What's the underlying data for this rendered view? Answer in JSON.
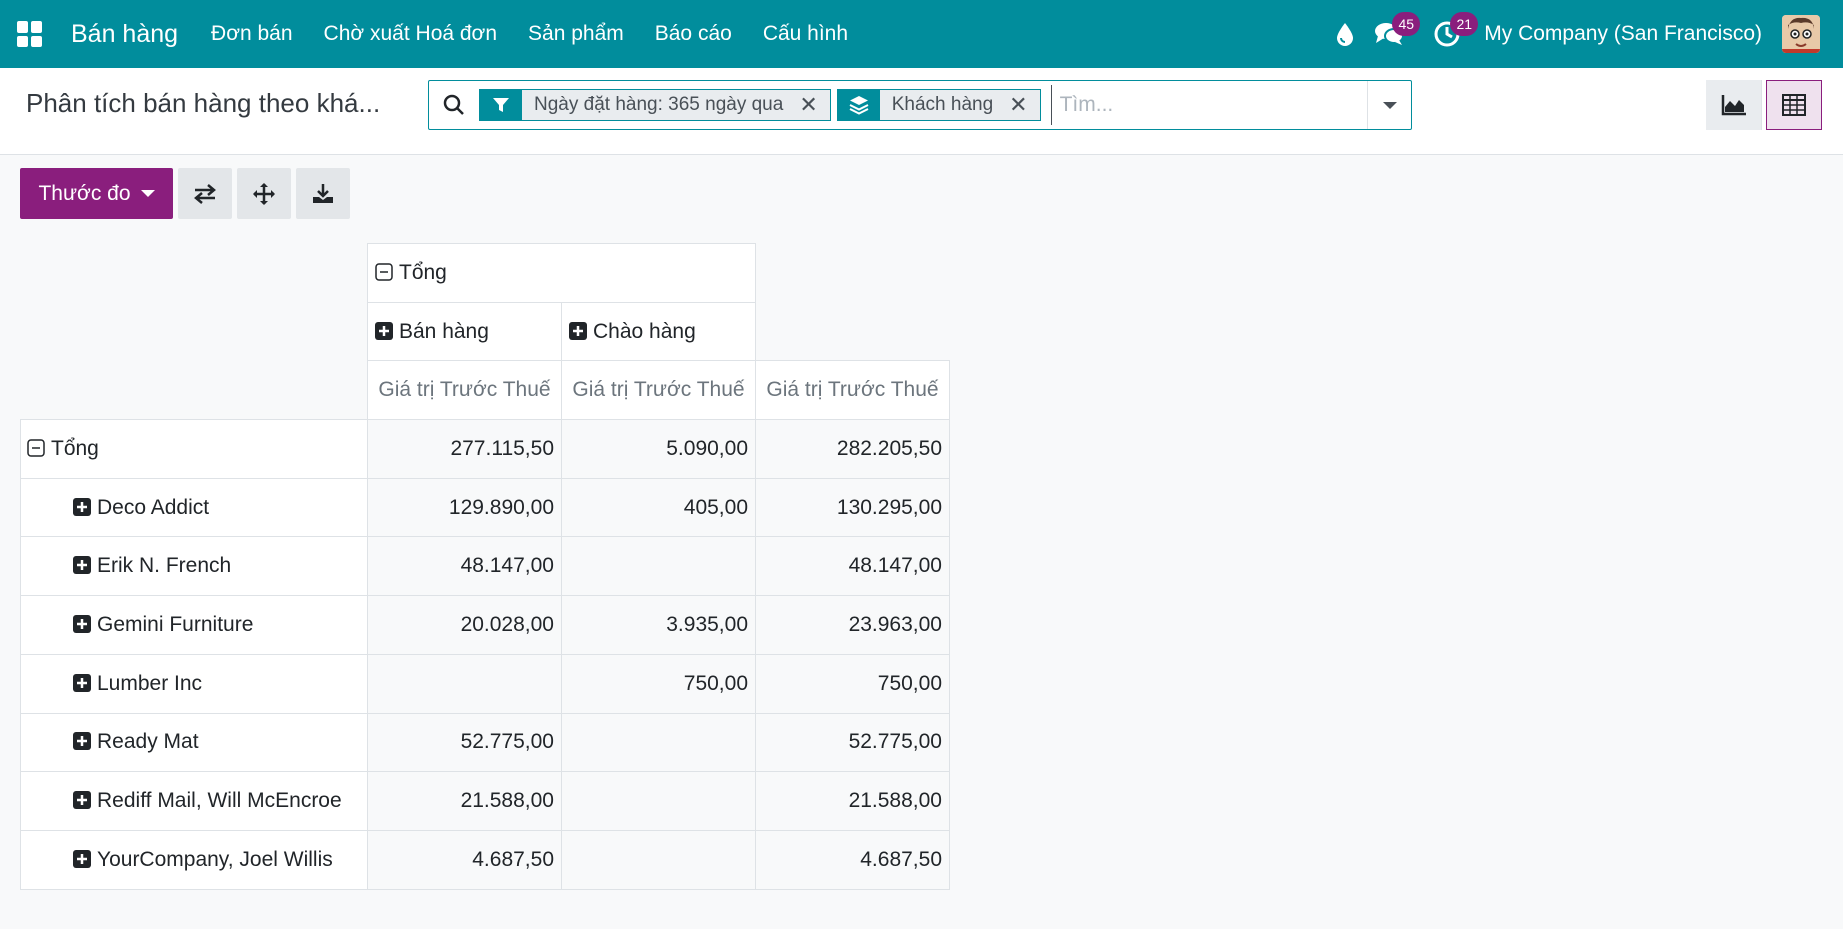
{
  "navbar": {
    "app_title": "Bán hàng",
    "menu": [
      "Đơn bán",
      "Chờ xuất Hoá đơn",
      "Sản phẩm",
      "Báo cáo",
      "Cấu hình"
    ],
    "messages_count": "45",
    "activities_count": "21",
    "company": "My Company (San Francisco)"
  },
  "control": {
    "breadcrumb": "Phân tích bán hàng theo khá...",
    "facets": [
      {
        "icon": "filter-icon",
        "label": "Ngày đặt hàng: 365 ngày qua"
      },
      {
        "icon": "group-by-icon",
        "label": "Khách hàng"
      }
    ],
    "search_placeholder": "Tìm..."
  },
  "buttons": {
    "measure_label": "Thước đo"
  },
  "pivot": {
    "col_total_label": "Tổng",
    "col_groups": [
      "Bán hàng",
      "Chào hàng"
    ],
    "measure_label": "Giá trị Trước Thuế",
    "row_total_label": "Tổng",
    "totals": [
      "277.115,50",
      "5.090,00",
      "282.205,50"
    ],
    "rows": [
      {
        "name": "Deco Addict",
        "values": [
          "129.890,00",
          "405,00",
          "130.295,00"
        ]
      },
      {
        "name": "Erik N. French",
        "values": [
          "48.147,00",
          "",
          "48.147,00"
        ]
      },
      {
        "name": "Gemini Furniture",
        "values": [
          "20.028,00",
          "3.935,00",
          "23.963,00"
        ]
      },
      {
        "name": "Lumber Inc",
        "values": [
          "",
          "750,00",
          "750,00"
        ]
      },
      {
        "name": "Ready Mat",
        "values": [
          "52.775,00",
          "",
          "52.775,00"
        ]
      },
      {
        "name": "Rediff Mail, Will McEncroe",
        "values": [
          "21.588,00",
          "",
          "21.588,00"
        ]
      },
      {
        "name": "YourCompany, Joel Willis",
        "values": [
          "4.687,50",
          "",
          "4.687,50"
        ]
      }
    ]
  }
}
